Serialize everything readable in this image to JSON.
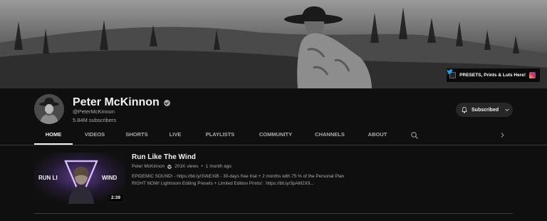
{
  "banner": {
    "links_label": "PRESETS, Prints & Luts Here!",
    "icons": [
      "link-icon",
      "instagram-icon",
      "twitter-icon"
    ]
  },
  "channel": {
    "name": "Peter McKinnon",
    "handle": "@PeterMcKinnon",
    "subscribers": "5.84M subscribers",
    "verified": true,
    "subscribe_label": "Subscribed"
  },
  "tabs": [
    {
      "label": "HOME",
      "active": true
    },
    {
      "label": "VIDEOS",
      "active": false
    },
    {
      "label": "SHORTS",
      "active": false
    },
    {
      "label": "LIVE",
      "active": false
    },
    {
      "label": "PLAYLISTS",
      "active": false
    },
    {
      "label": "COMMUNITY",
      "active": false
    },
    {
      "label": "CHANNELS",
      "active": false
    },
    {
      "label": "ABOUT",
      "active": false
    }
  ],
  "featured": {
    "title": "Run Like The Wind",
    "channel": "Peter McKinnon",
    "views": "201K views",
    "age": "1 month ago",
    "meta_separator": "•",
    "duration": "2:39",
    "thumb_text_left": "RUN LI",
    "thumb_text_right": "WIND",
    "description": "EPIDEMIC SOUND! - https://bit.ly/3VkEXiB - 30-days free trial + 2 months with 75 % of the Personal Plan RIGHT NOW! Lightroom Editing Presets + Limited Edition Prints! : https://bit.ly/3pAM2X9..."
  },
  "colors": {
    "background": "#0f0f0f",
    "text_primary": "#f1f1f1",
    "text_secondary": "#aaaaaa",
    "button_bg": "#272727",
    "thumb_glow": "#b07cff"
  }
}
